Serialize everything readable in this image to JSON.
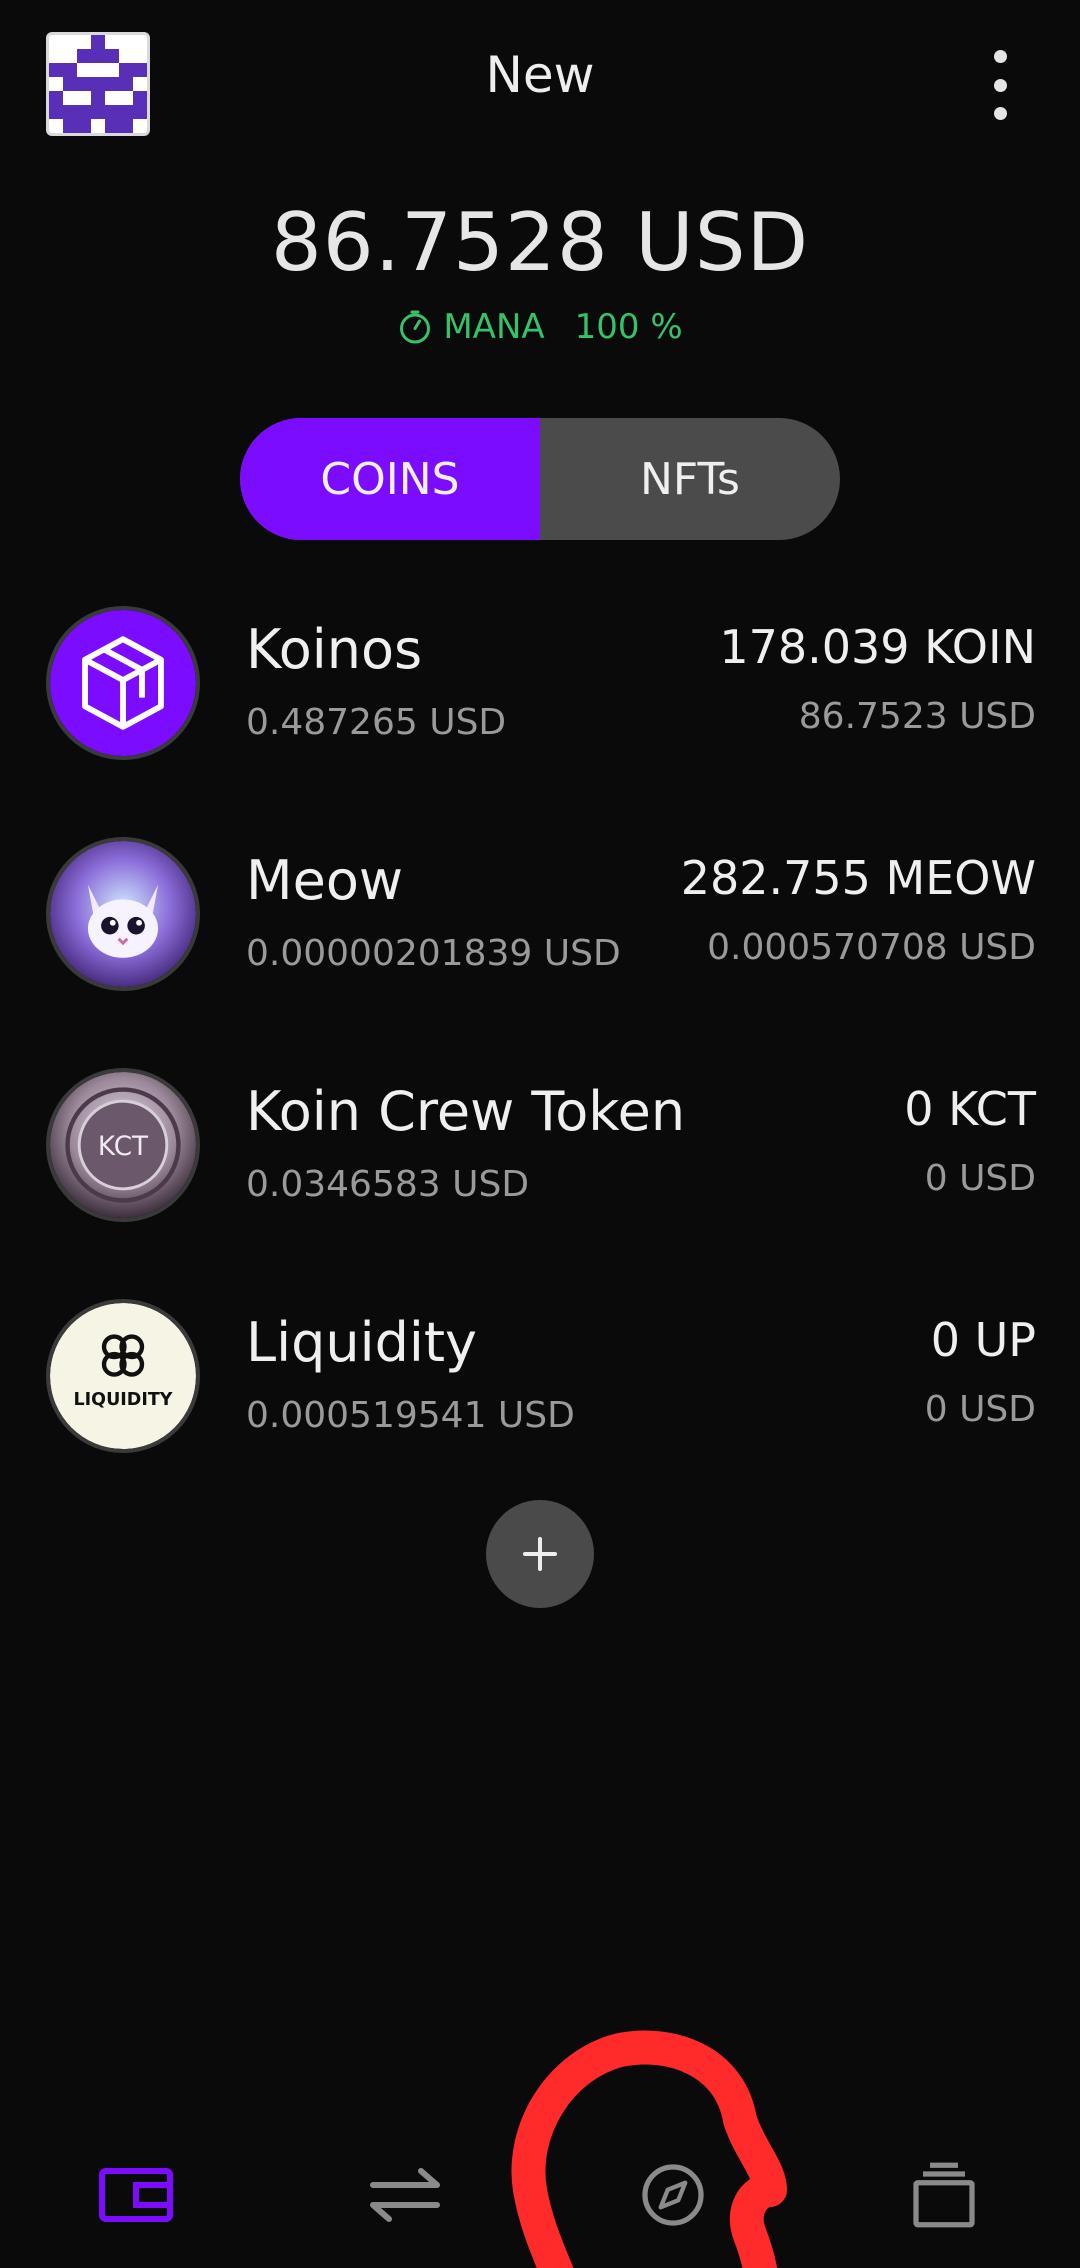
{
  "header": {
    "wallet_name": "New",
    "avatar_icon": "pixel-identicon",
    "menu_icon": "more-vertical-icon"
  },
  "balance": {
    "total": "86.7528 USD",
    "mana_label": "MANA",
    "mana_percent": "100 %",
    "mana_color": "#35c26b"
  },
  "tabs": [
    {
      "label": "COINS",
      "active": true
    },
    {
      "label": "NFTs",
      "active": false
    }
  ],
  "accent_color": "#7b0cff",
  "coins": [
    {
      "name": "Koinos",
      "price": "0.487265 USD",
      "amount": "178.039 KOIN",
      "value": "86.7523 USD",
      "icon": "koinos-cube-icon"
    },
    {
      "name": "Meow",
      "price": "0.00000201839 USD",
      "amount": "282.755 MEOW",
      "value": "0.000570708 USD",
      "icon": "meow-cat-icon"
    },
    {
      "name": "Koin Crew Token",
      "price": "0.0346583 USD",
      "amount": "0 KCT",
      "value": "0 USD",
      "icon": "kct-coin-icon",
      "logo_text": "KCT"
    },
    {
      "name": "Liquidity",
      "price": "0.000519541 USD",
      "amount": "0 UP",
      "value": "0 USD",
      "icon": "liquidity-logo-icon",
      "logo_text": "LIQUIDITY"
    }
  ],
  "add_button_icon": "plus-icon",
  "bottom_nav": [
    {
      "icon": "wallet-icon",
      "active": true
    },
    {
      "icon": "swap-arrows-icon",
      "active": false
    },
    {
      "icon": "compass-icon",
      "active": false
    },
    {
      "icon": "stack-icon",
      "active": false
    }
  ],
  "annotation": {
    "shape": "hand-drawn circle",
    "color": "#ff2a2a"
  }
}
